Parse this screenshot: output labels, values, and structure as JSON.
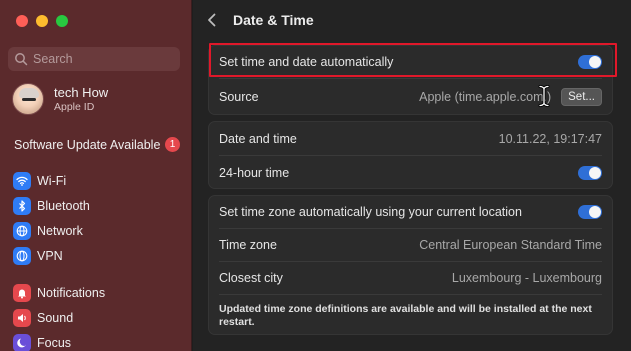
{
  "sidebar": {
    "search_placeholder": "Search",
    "profile": {
      "name": "tech How",
      "sub": "Apple ID"
    },
    "update": {
      "label": "Software Update Available",
      "badge": "1"
    },
    "items": [
      {
        "label": "Wi-Fi",
        "icon": "wifi-icon",
        "color": "#2f7cf6"
      },
      {
        "label": "Bluetooth",
        "icon": "bluetooth-icon",
        "color": "#2f7cf6"
      },
      {
        "label": "Network",
        "icon": "globe-icon",
        "color": "#2f7cf6"
      },
      {
        "label": "VPN",
        "icon": "vpn-icon",
        "color": "#2f7cf6"
      },
      {
        "label": "Notifications",
        "icon": "bell-icon",
        "color": "#e5484d"
      },
      {
        "label": "Sound",
        "icon": "speaker-icon",
        "color": "#e5484d"
      },
      {
        "label": "Focus",
        "icon": "moon-icon",
        "color": "#6a4fd8"
      }
    ]
  },
  "header": {
    "title": "Date & Time"
  },
  "card1": {
    "auto_label": "Set time and date automatically",
    "auto_on": true,
    "source_label": "Source",
    "source_value": "Apple (time.apple.com.)",
    "set_button": "Set..."
  },
  "card2": {
    "datetime_label": "Date and time",
    "datetime_value": "10.11.22, 19:17:47",
    "hour24_label": "24-hour time",
    "hour24_on": true
  },
  "card3": {
    "tz_auto_label": "Set time zone automatically using your current location",
    "tz_auto_on": true,
    "tz_label": "Time zone",
    "tz_value": "Central European Standard Time",
    "city_label": "Closest city",
    "city_value": "Luxembourg - Luxembourg",
    "note": "Updated time zone definitions are available and will be installed at the next restart."
  },
  "colors": {
    "sidebar": "#5b2a2c",
    "accent": "#2f6fd6",
    "highlight": "#e0182a"
  }
}
